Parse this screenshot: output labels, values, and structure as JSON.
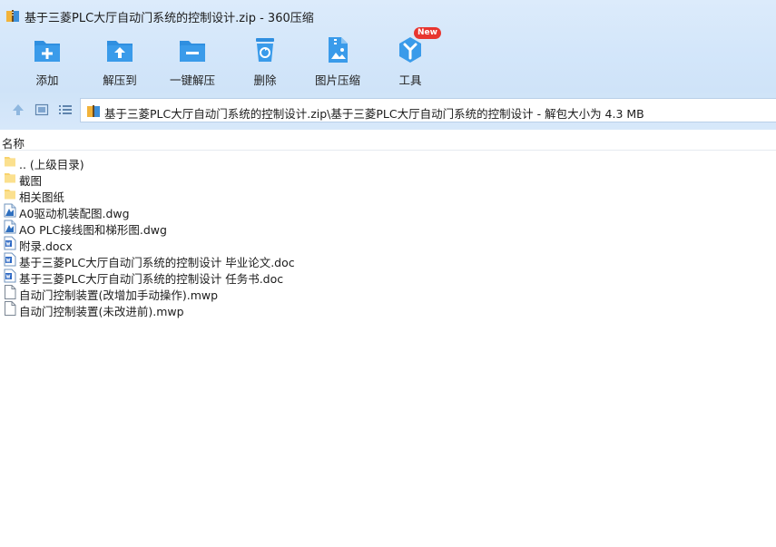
{
  "window": {
    "title": "基于三菱PLC大厅自动门系统的控制设计.zip - 360压缩"
  },
  "toolbar": [
    {
      "icon": "add-icon",
      "label": "添加"
    },
    {
      "icon": "extract-to-icon",
      "label": "解压到"
    },
    {
      "icon": "one-click-extract-icon",
      "label": "一键解压"
    },
    {
      "icon": "delete-icon",
      "label": "删除"
    },
    {
      "icon": "image-compress-icon",
      "label": "图片压缩"
    },
    {
      "icon": "tools-icon",
      "label": "工具",
      "badge": "New"
    }
  ],
  "nav": {
    "address": "基于三菱PLC大厅自动门系统的控制设计.zip\\基于三菱PLC大厅自动门系统的控制设计 - 解包大小为 4.3 MB"
  },
  "list": {
    "column_name": "名称",
    "files": [
      {
        "name": ".. (上级目录)",
        "icon": "folder-icon"
      },
      {
        "name": "截图",
        "icon": "folder-icon"
      },
      {
        "name": "相关图纸",
        "icon": "folder-icon"
      },
      {
        "name": "A0驱动机装配图.dwg",
        "icon": "dwg-file-icon"
      },
      {
        "name": "AO PLC接线图和梯形图.dwg",
        "icon": "dwg-file-icon"
      },
      {
        "name": "附录.docx",
        "icon": "word-file-icon"
      },
      {
        "name": "基于三菱PLC大厅自动门系统的控制设计 毕业论文.doc",
        "icon": "word-file-icon"
      },
      {
        "name": "基于三菱PLC大厅自动门系统的控制设计 任务书.doc",
        "icon": "word-file-icon"
      },
      {
        "name": "自动门控制装置(改增加手动操作).mwp",
        "icon": "generic-file-icon"
      },
      {
        "name": "自动门控制装置(未改进前).mwp",
        "icon": "generic-file-icon"
      }
    ]
  },
  "colors": {
    "accent": "#2f8fe0",
    "toolbar_bg": "#d3e6fa",
    "folder": "#f8d36d",
    "badge": "#e8352f"
  }
}
